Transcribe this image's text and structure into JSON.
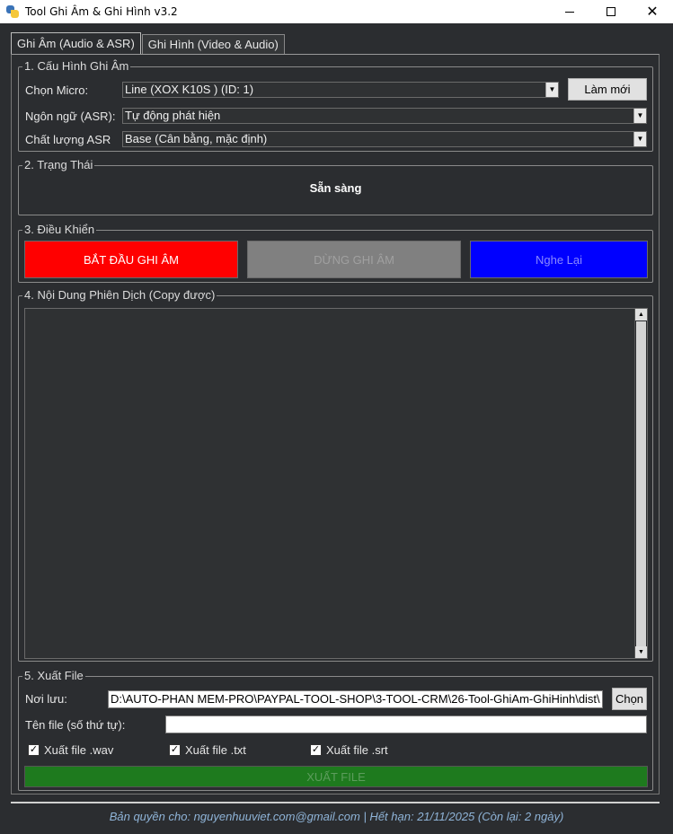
{
  "window": {
    "title": "Tool Ghi Âm & Ghi Hình v3.2",
    "minimize_symbol": "",
    "close_symbol": "✕"
  },
  "tabs": [
    {
      "label": "Ghi Âm (Audio & ASR)",
      "active": true
    },
    {
      "label": "Ghi Hình (Video & Audio)",
      "active": false
    }
  ],
  "config": {
    "legend": "1. Cấu Hình Ghi Âm",
    "micro_label": "Chọn Micro:",
    "micro_value": "Line (XOX K10S ) (ID: 1)",
    "refresh_button": "Làm mới",
    "language_label": "Ngôn ngữ (ASR):",
    "language_value": "Tự động phát hiện",
    "quality_label": "Chất lượng ASR",
    "quality_value": "Base (Cân bằng, mặc định)"
  },
  "status": {
    "legend": "2. Trạng Thái",
    "text": "Sẵn sàng"
  },
  "controls": {
    "legend": "3. Điều Khiển",
    "start_label": "BẮT ĐẦU GHI ÂM",
    "stop_label": "DỪNG GHI ÂM",
    "replay_label": "Nghe Lại",
    "colors": {
      "start": "#ff0000",
      "stop": "#808080",
      "replay": "#0000ff"
    }
  },
  "transcript": {
    "legend": "4. Nội Dung Phiên Dịch (Copy được)",
    "content": ""
  },
  "export": {
    "legend": "5. Xuất File",
    "save_label": "Nơi lưu:",
    "save_path": "D:\\AUTO-PHAN MEM-PRO\\PAYPAL-TOOL-SHOP\\3-TOOL-CRM\\26-Tool-GhiAm-GhiHinh\\dist\\",
    "choose_button": "Chọn",
    "filename_label": "Tên file (số thứ tự):",
    "filename_value": "",
    "checks": [
      {
        "label": "Xuất file .wav",
        "checked": true
      },
      {
        "label": "Xuất file .txt",
        "checked": true
      },
      {
        "label": "Xuất file .srt",
        "checked": true
      }
    ],
    "export_button": "XUẤT FILE",
    "export_color": "#1e7a1e"
  },
  "footer": {
    "text": "Bản quyền cho: nguyenhuuviet.com@gmail.com | Hết hạn: 21/11/2025 (Còn lại: 2 ngày)"
  }
}
